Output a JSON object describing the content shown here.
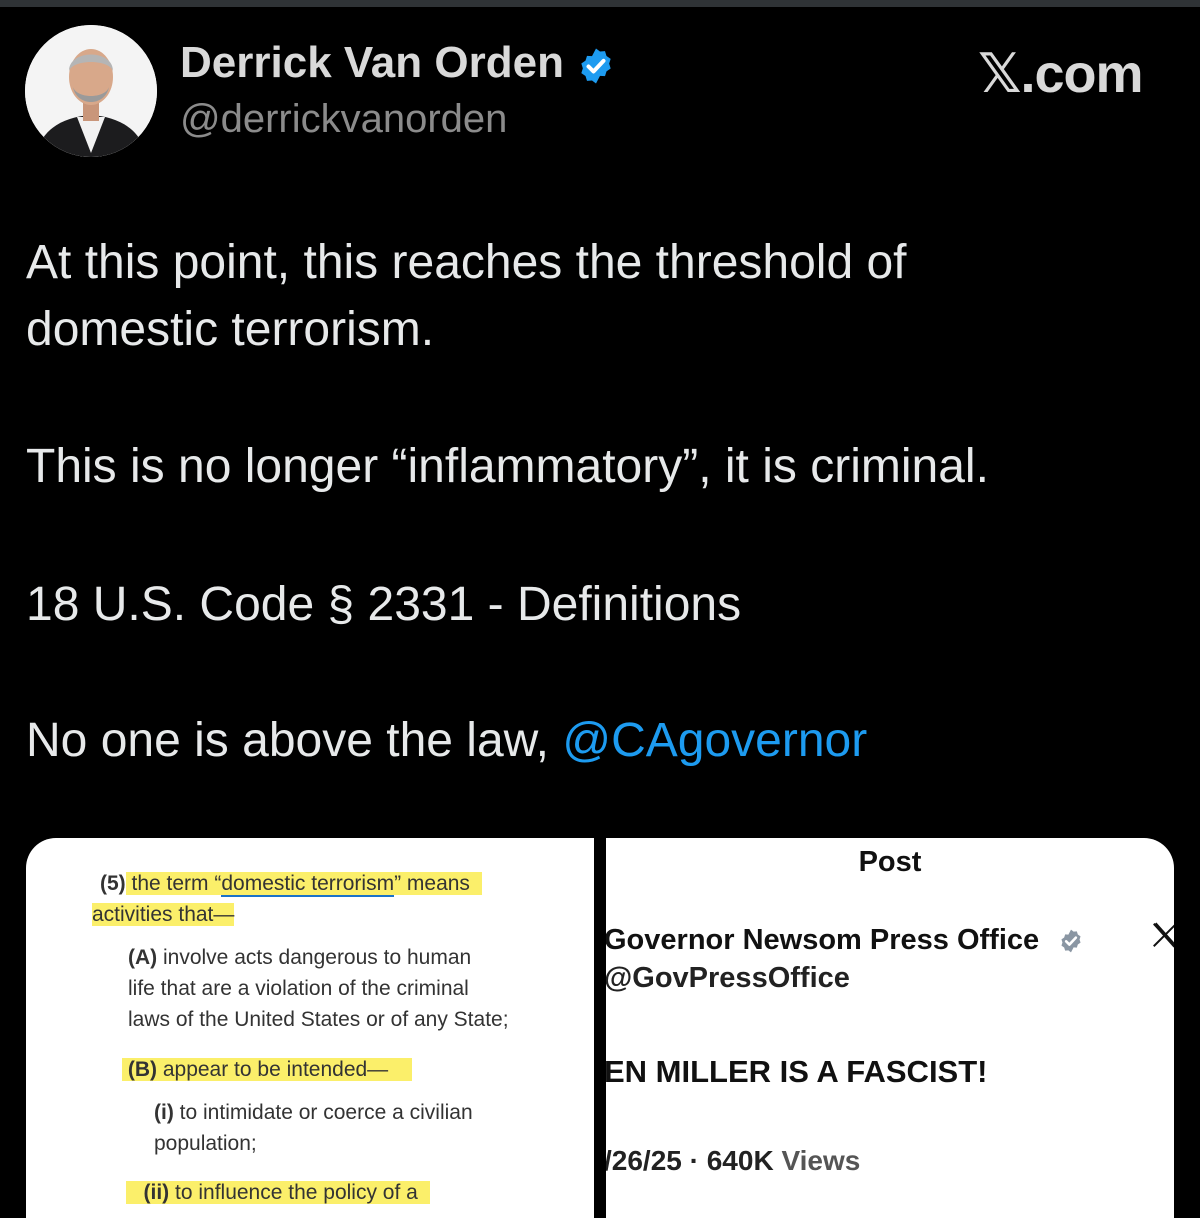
{
  "author": {
    "name": "Derrick Van Orden",
    "handle": "@derrickvanorden",
    "verified_icon": "verified-badge-icon",
    "avatar_icon": "profile-photo"
  },
  "brand": "𝕏.com",
  "tweet": {
    "line1": "At this point, this reaches the threshold of",
    "line2": "domestic terrorism.",
    "line3": "This is no longer “inflammatory”, it is criminal.",
    "line4": "18 U.S. Code § 2331 - Definitions",
    "line5_text": "No one is above the law, ",
    "line5_mention": "@CAgovernor"
  },
  "law_excerpt": {
    "p5_num": "(5)",
    "p5_a": " the term “",
    "p5_term": "domestic terrorism",
    "p5_b": "” means",
    "p5_line2": "activities that—",
    "a_num": "(A)",
    "a_line1": " involve acts dangerous to human",
    "a_line2": "life that are a violation of the criminal",
    "a_line3": "laws of the United States or of any State;",
    "b_num": "(B)",
    "b_text": " appear to be intended—",
    "i_num": "(i)",
    "i_line1": " to intimidate or coerce a civilian",
    "i_line2": "population;",
    "ii_num": "(ii)",
    "ii_text": " to influence the policy of a"
  },
  "embedded_post": {
    "header": "Post",
    "name": "Governor Newsom Press Office",
    "handle": "@GovPressOffice",
    "body": "EN MILLER IS A FASCIST!",
    "date": "/26/25 · ",
    "views_count": "640K",
    "views_label": " Views",
    "x_icon": "x-logo-icon"
  },
  "colors": {
    "background": "#000000",
    "text": "#e7e9ea",
    "mention": "#1d9bf0",
    "verified": "#1d9bf0",
    "highlight": "#fbef6a"
  }
}
